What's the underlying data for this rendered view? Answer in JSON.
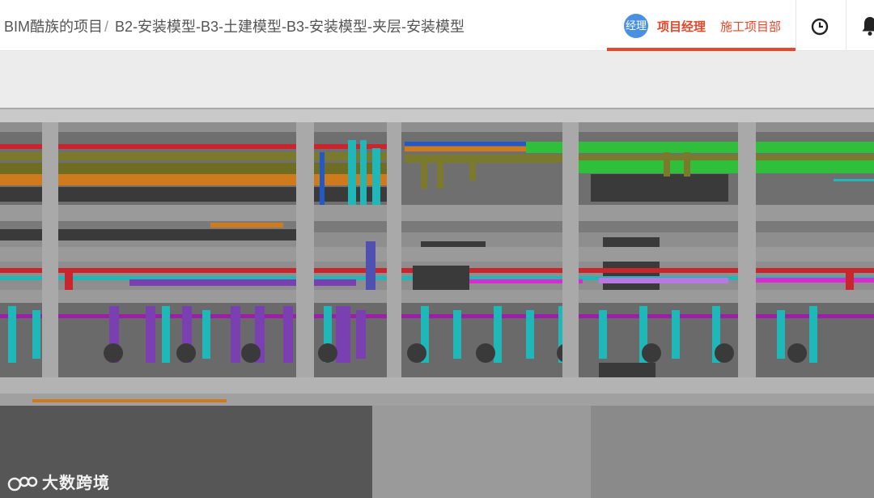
{
  "header": {
    "breadcrumb_root": "BIM酷族的项目",
    "breadcrumb_sep": "/",
    "breadcrumb_current": "B2-安装模型-B3-土建模型-B3-安装模型-夹层-安装模型",
    "role_avatar": "经理",
    "role_name": "项目经理",
    "department": "施工项目部",
    "clock_icon": "clock-icon",
    "bell_icon": "bell-icon"
  },
  "watermark": {
    "text": "大数跨境",
    "icon": "logo-icon"
  },
  "colors": {
    "accent": "#e8472a",
    "avatar": "#4a90e2",
    "pipe_green": "#2fbf3a",
    "pipe_cyan": "#1fb7b7",
    "pipe_purple": "#7a3fb0",
    "pipe_red": "#c8262c",
    "pipe_orange": "#d07a1e",
    "pipe_olive": "#7b7a2c"
  }
}
